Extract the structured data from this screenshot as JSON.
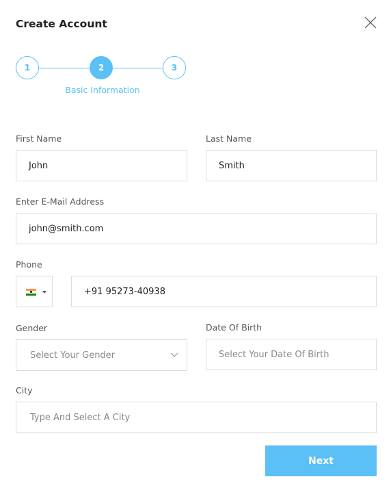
{
  "header": {
    "title": "Create Account",
    "close_icon": "close-icon"
  },
  "stepper": {
    "steps": [
      {
        "number": "1",
        "state": "done"
      },
      {
        "number": "2",
        "state": "active"
      },
      {
        "number": "3",
        "state": "pending"
      }
    ],
    "current_caption": "Basic Information",
    "accent_color": "#5ac0f5"
  },
  "form": {
    "first_name": {
      "label": "First Name",
      "value": "John"
    },
    "last_name": {
      "label": "Last Name",
      "value": "Smith"
    },
    "email": {
      "label": "Enter E-Mail Address",
      "value": "john@smith.com"
    },
    "phone": {
      "label": "Phone",
      "country_flag": "india-flag-icon",
      "value": "+91 95273-40938"
    },
    "gender": {
      "label": "Gender",
      "placeholder": "Select Your Gender"
    },
    "dob": {
      "label": "Date Of Birth",
      "placeholder": "Select Your Date Of Birth"
    },
    "city": {
      "label": "City",
      "placeholder": "Type And Select A City"
    }
  },
  "actions": {
    "next_label": "Next"
  }
}
